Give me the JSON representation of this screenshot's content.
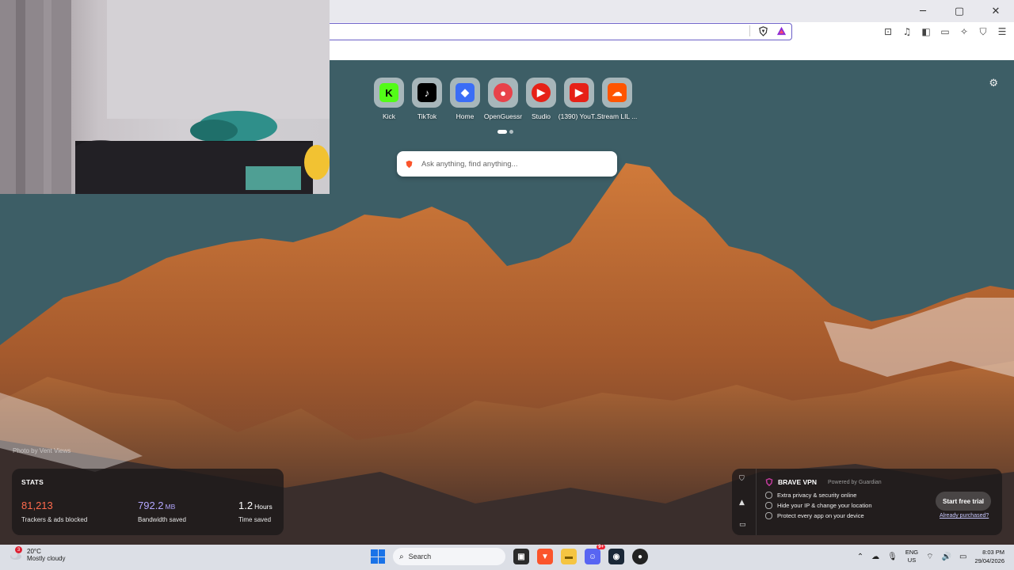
{
  "window": {
    "minimize": "─",
    "maximize": "▢",
    "close": "✕"
  },
  "top_sites": [
    {
      "label": "Kick",
      "icon": "kick-icon",
      "color": "#53fc18",
      "glyph": "K"
    },
    {
      "label": "TikTok",
      "icon": "tiktok-icon",
      "color": "#000000",
      "glyph": "♪"
    },
    {
      "label": "Home",
      "icon": "roblox-icon",
      "color": "#3b6df6",
      "glyph": "◆"
    },
    {
      "label": "OpenGuessr",
      "icon": "openguessr-icon",
      "color": "#e8424a",
      "glyph": "●"
    },
    {
      "label": "Studio",
      "icon": "youtube-studio-icon",
      "color": "#e62117",
      "glyph": "▶"
    },
    {
      "label": "(1390) YouT...",
      "icon": "youtube-icon",
      "color": "#e62117",
      "glyph": "▶"
    },
    {
      "label": "Stream LIL ...",
      "icon": "soundcloud-icon",
      "color": "#ff5500",
      "glyph": "☁"
    }
  ],
  "search": {
    "placeholder": "Ask anything, find anything..."
  },
  "photo_credit": "Photo by Vent Views",
  "stats": {
    "title": "STATS",
    "trackers": {
      "value": "81,213",
      "label": "Trackers & ads blocked",
      "color": "#ff6a4d"
    },
    "bandwidth": {
      "value": "792.2",
      "unit": "MB",
      "label": "Bandwidth saved",
      "color": "#b3a7ff"
    },
    "time": {
      "value": "1.2",
      "unit": "Hours",
      "label": "Time saved"
    }
  },
  "vpn": {
    "title": "BRAVE VPN",
    "powered_by": "Powered by Guardian",
    "features": [
      "Extra privacy & security online",
      "Hide your IP & change your location",
      "Protect every app on your device"
    ],
    "cta": "Start free trial",
    "link": "Already purchased?"
  },
  "taskbar": {
    "weather": {
      "temp": "20°C",
      "desc": "Mostly cloudy",
      "badge": "3"
    },
    "search_label": "Search",
    "lang_top": "ENG",
    "lang_bottom": "US",
    "time": "8:03 PM",
    "date": "29/04/2026",
    "discord_badge": "9+"
  }
}
